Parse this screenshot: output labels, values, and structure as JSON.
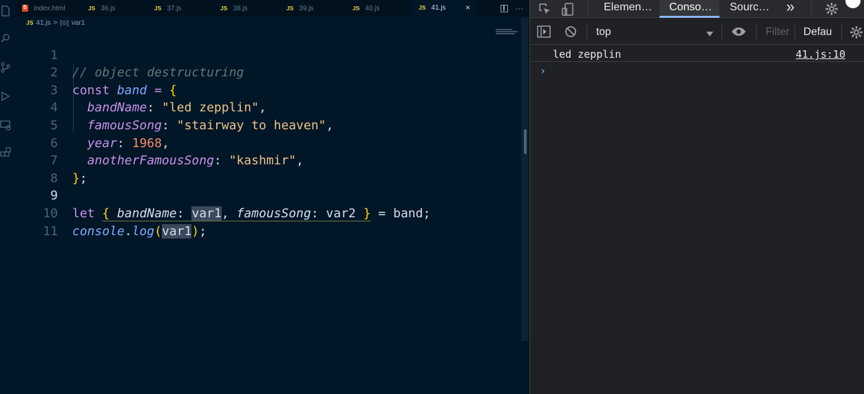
{
  "editor": {
    "tabs": [
      {
        "label": "index.html",
        "kind": "html"
      },
      {
        "label": "36.js",
        "kind": "js"
      },
      {
        "label": "37.js",
        "kind": "js"
      },
      {
        "label": "38.js",
        "kind": "js"
      },
      {
        "label": "39.js",
        "kind": "js"
      },
      {
        "label": "40.js",
        "kind": "js"
      },
      {
        "label": "41.js",
        "kind": "js",
        "active": true
      }
    ],
    "js_badge": "JS",
    "close_glyph": "×",
    "more_glyph": "···",
    "breadcrumb": {
      "file": "41.js",
      "separator": ">",
      "symbol_icon": "[⊙]",
      "symbol": "var1"
    },
    "current_line": 9,
    "lines": [
      {
        "n": "1"
      },
      {
        "n": "2"
      },
      {
        "n": "3"
      },
      {
        "n": "4"
      },
      {
        "n": "5"
      },
      {
        "n": "6"
      },
      {
        "n": "7"
      },
      {
        "n": "8"
      },
      {
        "n": "9"
      },
      {
        "n": "10"
      },
      {
        "n": "11"
      }
    ],
    "code": {
      "l1_comment": "// object destructuring",
      "l2_const": "const",
      "l2_name": "band",
      "l2_eq": " = ",
      "l2_brace": "{",
      "l3_key": "bandName",
      "l3_val": "\"led zepplin\"",
      "l4_key": "famousSong",
      "l4_val": "\"stairway to heaven\"",
      "l5_key": "year",
      "l5_val": "1968",
      "l6_key": "anotherFamousSong",
      "l6_val": "\"kashmir\"",
      "l7_brace": "}",
      "l9_let": "let",
      "l9_open": "{",
      "l9_key1": "bandName",
      "l9_var1": "var1",
      "l9_key2": "famousSong",
      "l9_var2": "var2",
      "l9_close": "}",
      "l9_rest": " = band;",
      "l10_obj": "console",
      "l10_fn": "log",
      "l10_arg": "var1"
    }
  },
  "devtools": {
    "tabs": [
      "Elemen…",
      "Conso…",
      "Sourc…"
    ],
    "active_tab": "Conso…",
    "more_tabs": "»",
    "context": "top",
    "filter_placeholder": "Filter",
    "levels": "Defau",
    "log": {
      "message": "led zepplin",
      "source": "41.js:10"
    },
    "prompt": "›"
  }
}
